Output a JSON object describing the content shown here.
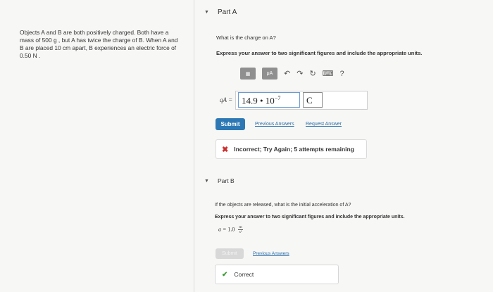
{
  "problem": {
    "text": "Objects A and B are both positively charged. Both have a mass of 500 g , but A has twice the charge of B. When A and B are placed 10 cm apart, B experiences an electric force of 0.50 N ."
  },
  "partA": {
    "title": "Part A",
    "question": "What is the charge on A?",
    "instruction": "Express your answer to two significant figures and include the appropriate units.",
    "toolbar": {
      "btn1": "▦",
      "btn2": "μA",
      "undo": "↶",
      "redo": "↷",
      "reset": "↻",
      "keyboard": "⌨",
      "help": "?"
    },
    "answer": {
      "variable": "qA =",
      "value_base": "14.9 • 10",
      "value_exp": "−7",
      "unit": "C"
    },
    "submit_label": "Submit",
    "previous_answers_label": "Previous Answers",
    "request_answer_label": "Request Answer",
    "feedback_icon": "✖",
    "feedback_text": "Incorrect; Try Again; 5 attempts remaining"
  },
  "partB": {
    "title": "Part B",
    "question": "If the objects are released, what is the initial acceleration of A?",
    "instruction": "Express your answer to two significant figures and include the appropriate units.",
    "answer": {
      "variable": "a =",
      "value": "1.0",
      "unit_num": "m",
      "unit_den": "s²"
    },
    "submit_label": "Submit",
    "previous_answers_label": "Previous Answers",
    "feedback_icon": "✔",
    "feedback_text": "Correct"
  },
  "colors": {
    "submit": "#2d78b4",
    "link": "#2d6fa8",
    "incorrect": "#d12b2b",
    "correct": "#3f9c36"
  }
}
